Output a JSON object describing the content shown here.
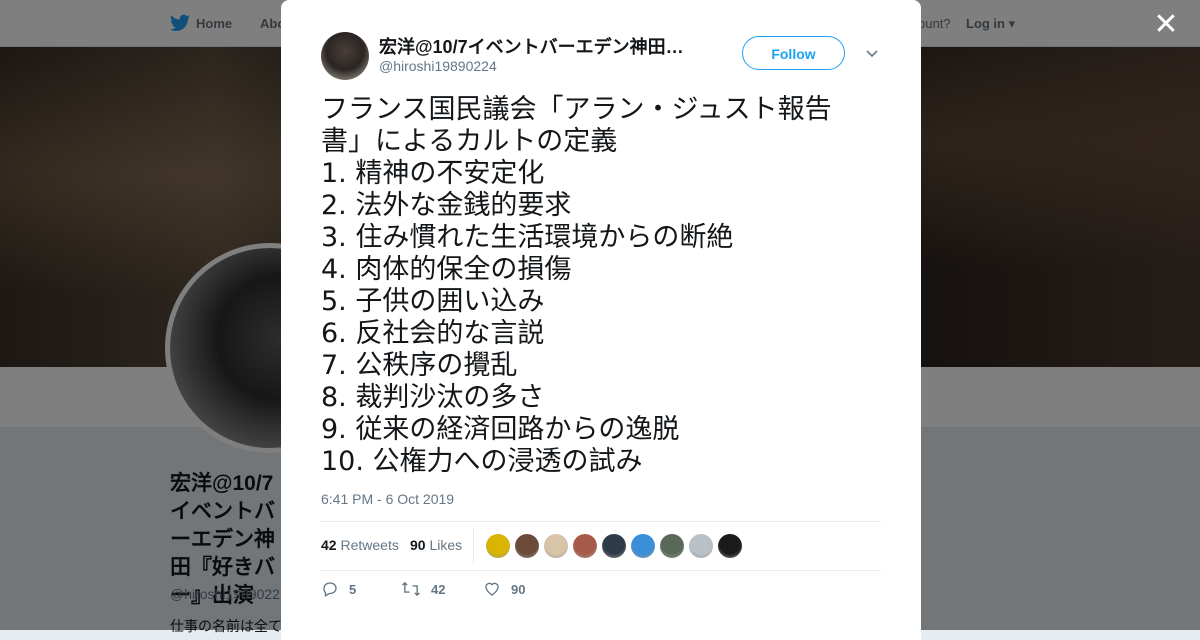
{
  "topbar": {
    "home_label": "Home",
    "about_label": "Abo",
    "account_prompt": "ccount?",
    "login_label": "Log in"
  },
  "profile": {
    "name": "宏洋@10/7イベントバーエデン神田『好きバー』出演",
    "handle": "@hiroshi1989022",
    "bio": "仕事の名前は全て"
  },
  "modal": {
    "author_name": "宏洋@10/7イベントバーエデン神田…",
    "author_handle": "@hiroshi19890224",
    "follow_label": "Follow",
    "tweet_lines": [
      "フランス国民議会「アラン・ジュスト報告",
      "書」によるカルトの定義",
      "1. 精神の不安定化",
      "2. 法外な金銭的要求",
      "3. 住み慣れた生活環境からの断絶",
      "4. 肉体的保全の損傷",
      "5. 子供の囲い込み",
      "6. 反社会的な言説",
      "7. 公秩序の攪乱",
      "8. 裁判沙汰の多さ",
      "9. 従来の経済回路からの逸脱",
      "10. 公権力への浸透の試み"
    ],
    "timestamp": "6:41 PM - 6 Oct 2019",
    "retweets_count": "42",
    "retweets_label": "Retweets",
    "likes_count": "90",
    "likes_label": "Likes",
    "liker_colors": [
      "#d9b400",
      "#6b4a3a",
      "#d8c4a8",
      "#a85a4a",
      "#2f3b4a",
      "#3a8fd8",
      "#5a6a5a",
      "#b8c0c8",
      "#1a1a1a"
    ],
    "replies": "5",
    "retweets_action": "42",
    "likes_action": "90"
  },
  "colors": {
    "accent": "#1da1f2",
    "text": "#14171a",
    "secondary": "#657786"
  }
}
